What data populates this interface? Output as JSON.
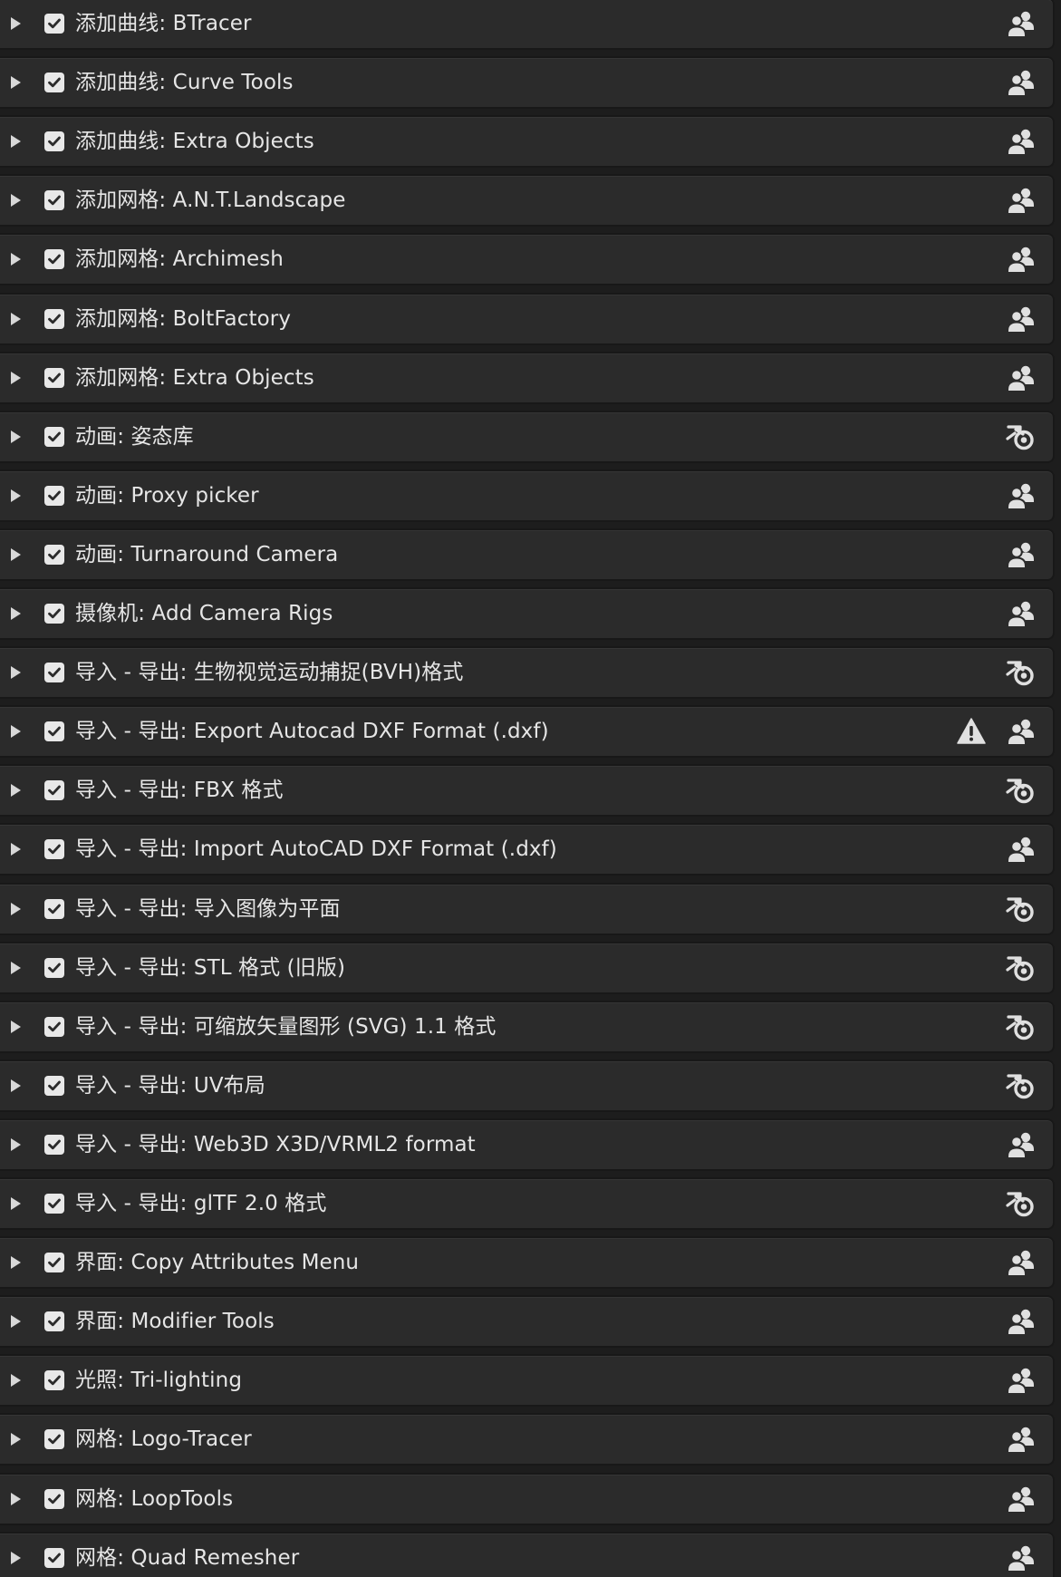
{
  "addons": [
    {
      "label": "添加曲线: BTracer",
      "enabled": true,
      "source_icon": "community-icon"
    },
    {
      "label": "添加曲线: Curve Tools",
      "enabled": true,
      "source_icon": "community-icon"
    },
    {
      "label": "添加曲线: Extra Objects",
      "enabled": true,
      "source_icon": "community-icon"
    },
    {
      "label": "添加网格: A.N.T.Landscape",
      "enabled": true,
      "source_icon": "community-icon"
    },
    {
      "label": "添加网格: Archimesh",
      "enabled": true,
      "source_icon": "community-icon"
    },
    {
      "label": "添加网格: BoltFactory",
      "enabled": true,
      "source_icon": "community-icon"
    },
    {
      "label": "添加网格: Extra Objects",
      "enabled": true,
      "source_icon": "community-icon"
    },
    {
      "label": "动画: 姿态库",
      "enabled": true,
      "source_icon": "blender-icon"
    },
    {
      "label": "动画: Proxy picker",
      "enabled": true,
      "source_icon": "community-icon"
    },
    {
      "label": "动画: Turnaround Camera",
      "enabled": true,
      "source_icon": "community-icon"
    },
    {
      "label": "摄像机: Add Camera Rigs",
      "enabled": true,
      "source_icon": "community-icon"
    },
    {
      "label": "导入 - 导出: 生物视觉运动捕捉(BVH)格式",
      "enabled": true,
      "source_icon": "blender-icon"
    },
    {
      "label": "导入 - 导出: Export Autocad DXF Format (.dxf)",
      "enabled": true,
      "source_icon": "community-icon",
      "warning": true
    },
    {
      "label": "导入 - 导出: FBX 格式",
      "enabled": true,
      "source_icon": "blender-icon"
    },
    {
      "label": "导入 - 导出: Import AutoCAD DXF Format (.dxf)",
      "enabled": true,
      "source_icon": "community-icon"
    },
    {
      "label": "导入 - 导出: 导入图像为平面",
      "enabled": true,
      "source_icon": "blender-icon"
    },
    {
      "label": "导入 - 导出: STL 格式 (旧版)",
      "enabled": true,
      "source_icon": "blender-icon"
    },
    {
      "label": "导入 - 导出: 可缩放矢量图形 (SVG) 1.1 格式",
      "enabled": true,
      "source_icon": "blender-icon"
    },
    {
      "label": "导入 - 导出: UV布局",
      "enabled": true,
      "source_icon": "blender-icon"
    },
    {
      "label": "导入 - 导出: Web3D X3D/VRML2 format",
      "enabled": true,
      "source_icon": "community-icon"
    },
    {
      "label": "导入 - 导出: glTF 2.0 格式",
      "enabled": true,
      "source_icon": "blender-icon"
    },
    {
      "label": "界面: Copy Attributes Menu",
      "enabled": true,
      "source_icon": "community-icon"
    },
    {
      "label": "界面: Modifier Tools",
      "enabled": true,
      "source_icon": "community-icon"
    },
    {
      "label": "光照: Tri-lighting",
      "enabled": true,
      "source_icon": "community-icon"
    },
    {
      "label": "网格: Logo-Tracer",
      "enabled": true,
      "source_icon": "community-icon"
    },
    {
      "label": "网格: LoopTools",
      "enabled": true,
      "source_icon": "community-icon"
    },
    {
      "label": "网格: Quad Remesher",
      "enabled": true,
      "source_icon": "community-icon"
    }
  ],
  "colors": {
    "row_bg": "#2b2b2b",
    "text": "#e6e6e6",
    "checkbox": "#e8e8e8",
    "icon": "#e0e0e0"
  }
}
